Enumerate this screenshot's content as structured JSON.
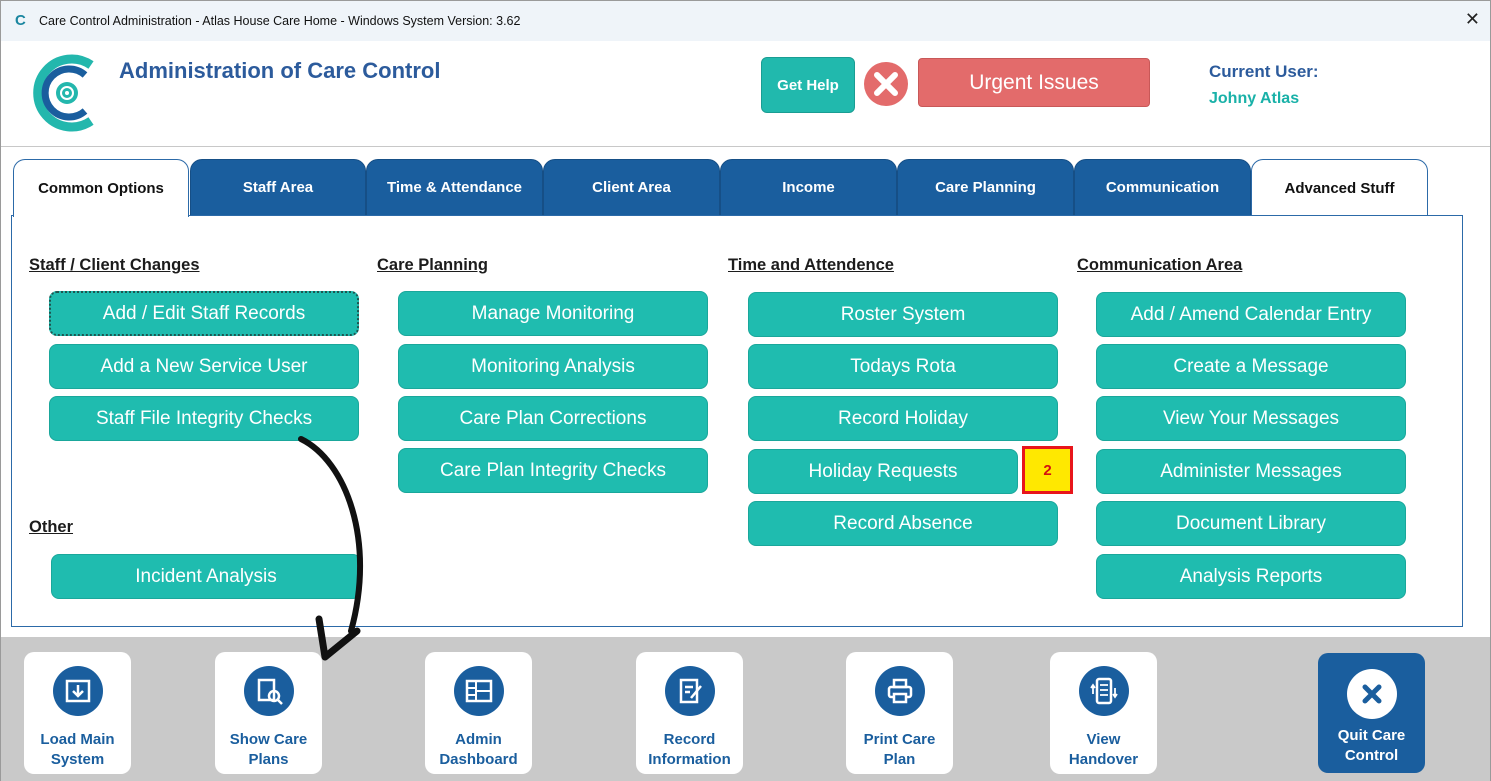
{
  "window": {
    "logo_glyph": "C",
    "title": "Care Control Administration - Atlas House Care Home - Windows System Version: 3.62",
    "close_glyph": "✕"
  },
  "header": {
    "title": "Administration of Care Control",
    "help_label": "Get Help",
    "urgent_label": "Urgent Issues",
    "user_label": "Current User:",
    "user_name": "Johny Atlas"
  },
  "tabs": [
    {
      "label": "Common Options",
      "active": true
    },
    {
      "label": "Staff Area"
    },
    {
      "label": "Time & Attendance"
    },
    {
      "label": "Client Area"
    },
    {
      "label": "Income"
    },
    {
      "label": "Care Planning"
    },
    {
      "label": "Communication"
    },
    {
      "label": "Advanced Stuff"
    }
  ],
  "sections": {
    "staff_client": {
      "title": "Staff / Client Changes",
      "buttons": [
        "Add / Edit Staff Records",
        "Add a New Service User",
        "Staff File Integrity Checks"
      ]
    },
    "care_planning": {
      "title": "Care Planning",
      "buttons": [
        "Manage Monitoring",
        "Monitoring Analysis",
        "Care Plan Corrections",
        "Care Plan Integrity Checks"
      ]
    },
    "time_attendance": {
      "title": "Time and Attendence",
      "buttons": [
        "Roster System",
        "Todays Rota",
        "Record Holiday",
        "Holiday Requests",
        "Record Absence"
      ],
      "holiday_badge": "2"
    },
    "communication": {
      "title": "Communication Area",
      "buttons": [
        "Add / Amend Calendar Entry",
        "Create a Message",
        "View Your Messages",
        "Administer Messages",
        "Document Library",
        "Analysis Reports"
      ]
    },
    "other": {
      "title": "Other",
      "buttons": [
        "Incident Analysis"
      ]
    }
  },
  "bottom_tiles": [
    {
      "line1": "Load Main",
      "line2": "System",
      "icon": "download-tray-icon"
    },
    {
      "line1": "Show Care",
      "line2": "Plans",
      "icon": "document-search-icon"
    },
    {
      "line1": "Admin",
      "line2": "Dashboard",
      "icon": "dashboard-icon"
    },
    {
      "line1": "Record",
      "line2": "Information",
      "icon": "edit-document-icon"
    },
    {
      "line1": "Print Care",
      "line2": "Plan",
      "icon": "printer-icon"
    },
    {
      "line1": "View",
      "line2": "Handover",
      "icon": "handover-list-icon"
    },
    {
      "line1": "Quit Care",
      "line2": "Control",
      "icon": "close-circle-icon"
    }
  ],
  "colors": {
    "teal": "#1fbcaf",
    "navy": "#1a5e9e",
    "urgent_red": "#e36b6b",
    "badge_yellow": "#ffe800"
  }
}
